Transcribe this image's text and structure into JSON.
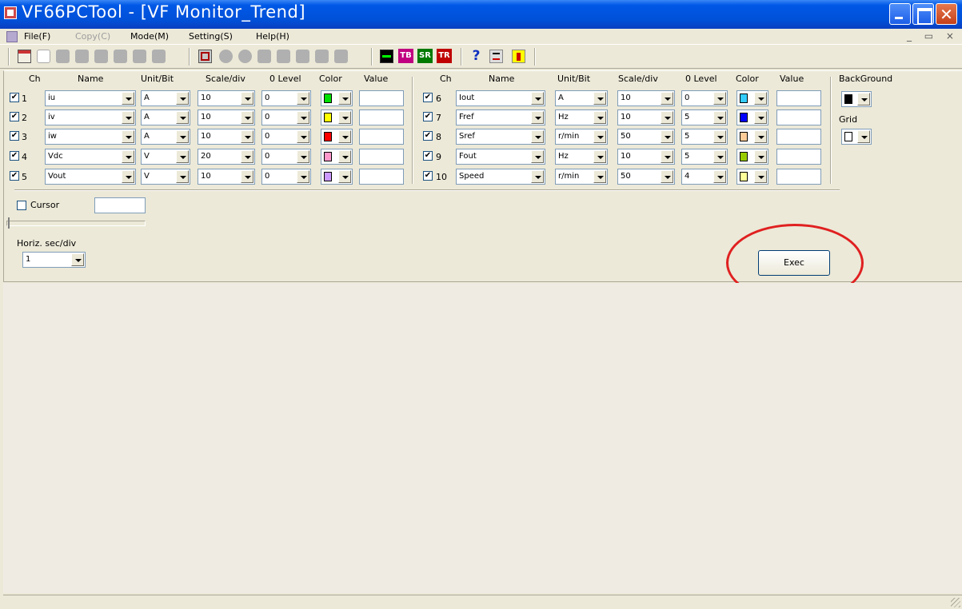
{
  "window": {
    "title": "VF66PCTool - [VF Monitor_Trend]"
  },
  "menu": {
    "items": [
      {
        "label": "File(F)",
        "enabled": true
      },
      {
        "label": "Copy(C)",
        "enabled": false
      },
      {
        "label": "Mode(M)",
        "enabled": true
      },
      {
        "label": "Setting(S)",
        "enabled": true
      },
      {
        "label": "Help(H)",
        "enabled": true
      }
    ],
    "mdi_controls": "_ ▭ ×"
  },
  "toolbar": {
    "text_icons": [
      "TB",
      "SR",
      "TR"
    ],
    "help_icon": "?"
  },
  "headers": {
    "ch": "Ch",
    "name": "Name",
    "unit": "Unit/Bit",
    "scale": "Scale/div",
    "zero": "0 Level",
    "color": "Color",
    "value": "Value",
    "background": "BackGround",
    "grid": "Grid"
  },
  "channels": [
    {
      "num": "1",
      "checked": true,
      "name": "iu",
      "unit": "A",
      "scale": "10",
      "zero": "0",
      "color": "#00e000",
      "value": ""
    },
    {
      "num": "2",
      "checked": true,
      "name": "iv",
      "unit": "A",
      "scale": "10",
      "zero": "0",
      "color": "#ffff00",
      "value": ""
    },
    {
      "num": "3",
      "checked": true,
      "name": "iw",
      "unit": "A",
      "scale": "10",
      "zero": "0",
      "color": "#ff0000",
      "value": ""
    },
    {
      "num": "4",
      "checked": true,
      "name": "Vdc",
      "unit": "V",
      "scale": "20",
      "zero": "0",
      "color": "#ff99cc",
      "value": ""
    },
    {
      "num": "5",
      "checked": true,
      "name": "Vout",
      "unit": "V",
      "scale": "10",
      "zero": "0",
      "color": "#cc99ff",
      "value": ""
    },
    {
      "num": "6",
      "checked": true,
      "name": "Iout",
      "unit": "A",
      "scale": "10",
      "zero": "0",
      "color": "#33ccff",
      "value": ""
    },
    {
      "num": "7",
      "checked": true,
      "name": "Fref",
      "unit": "Hz",
      "scale": "10",
      "zero": "5",
      "color": "#0000ff",
      "value": ""
    },
    {
      "num": "8",
      "checked": true,
      "name": "Sref",
      "unit": "r/min",
      "scale": "50",
      "zero": "5",
      "color": "#ffcc99",
      "value": ""
    },
    {
      "num": "9",
      "checked": true,
      "name": "Fout",
      "unit": "Hz",
      "scale": "10",
      "zero": "5",
      "color": "#99cc00",
      "value": ""
    },
    {
      "num": "10",
      "checked": true,
      "name": "Speed",
      "unit": "r/min",
      "scale": "50",
      "zero": "4",
      "color": "#ffff99",
      "value": ""
    }
  ],
  "background_color": "#000000",
  "grid_color": "#ffffff",
  "cursor": {
    "label": "Cursor",
    "checked": false,
    "value": "",
    "slider_position": 0
  },
  "horizontal": {
    "label": "Horiz. sec/div",
    "value": "1"
  },
  "exec_label": "Exec"
}
